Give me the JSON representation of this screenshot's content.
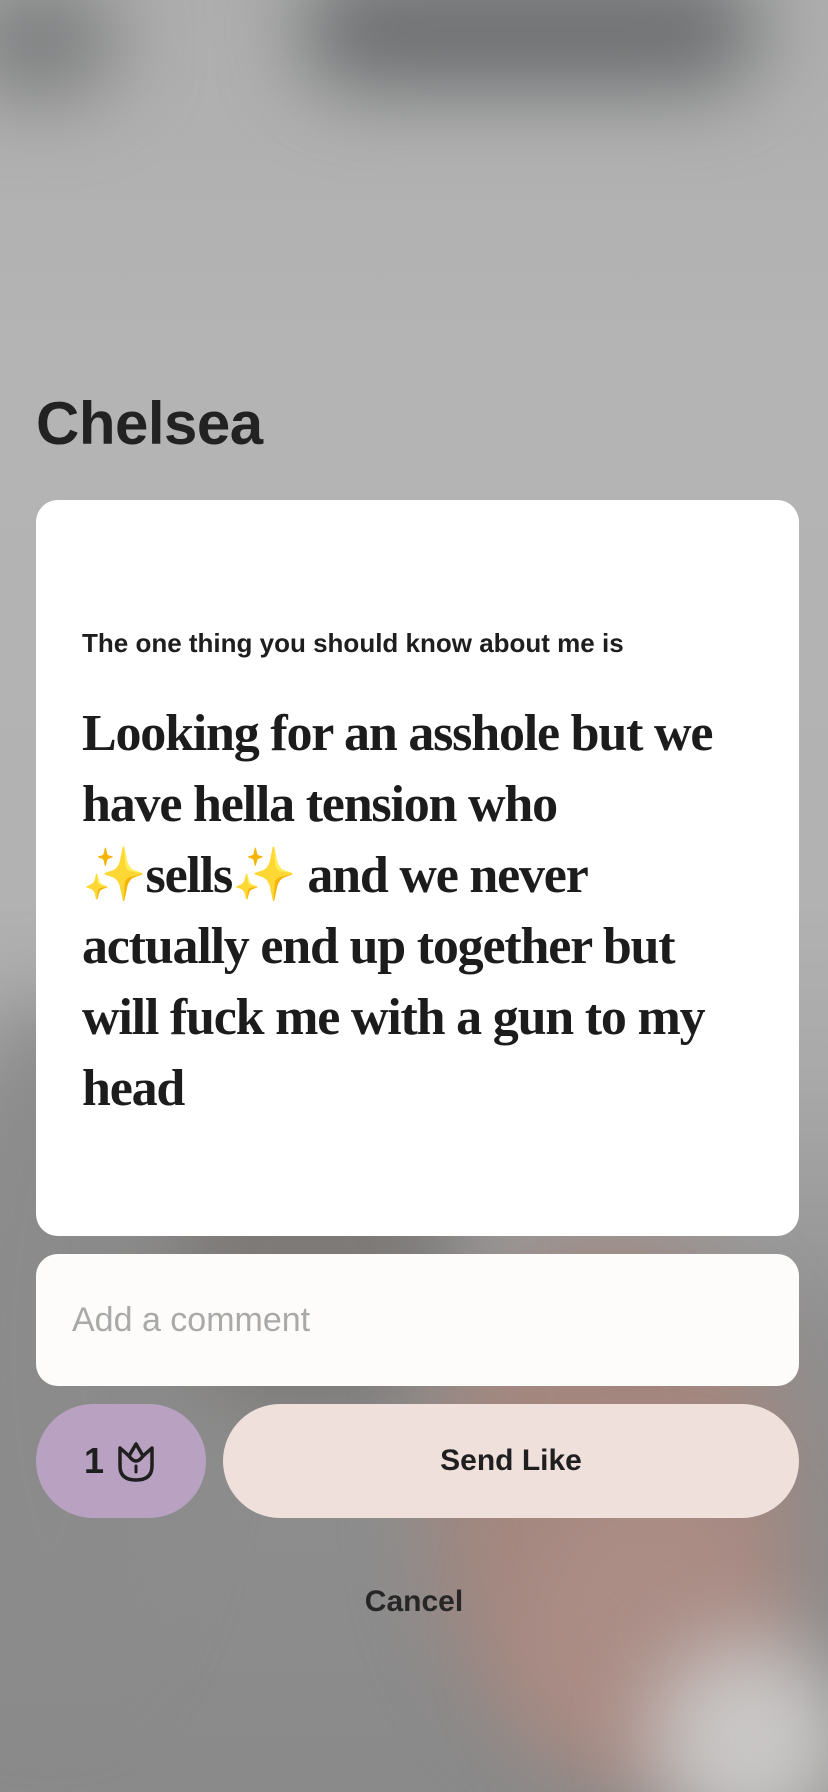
{
  "profile": {
    "name": "Chelsea"
  },
  "prompt": {
    "question": "The one thing you should know about me is",
    "answer": "Looking for an asshole but we have hella tension who ✨sells✨ and we never actually end up together but will fuck me with a gun to my head"
  },
  "comment": {
    "placeholder": "Add a comment",
    "value": ""
  },
  "rose": {
    "count": "1",
    "icon": "rose-icon"
  },
  "actions": {
    "send_label": "Send Like",
    "cancel_label": "Cancel"
  },
  "colors": {
    "rose_button": "#b8a1c1",
    "send_button": "#efe0dc",
    "sparkle": "#f2c94c"
  }
}
